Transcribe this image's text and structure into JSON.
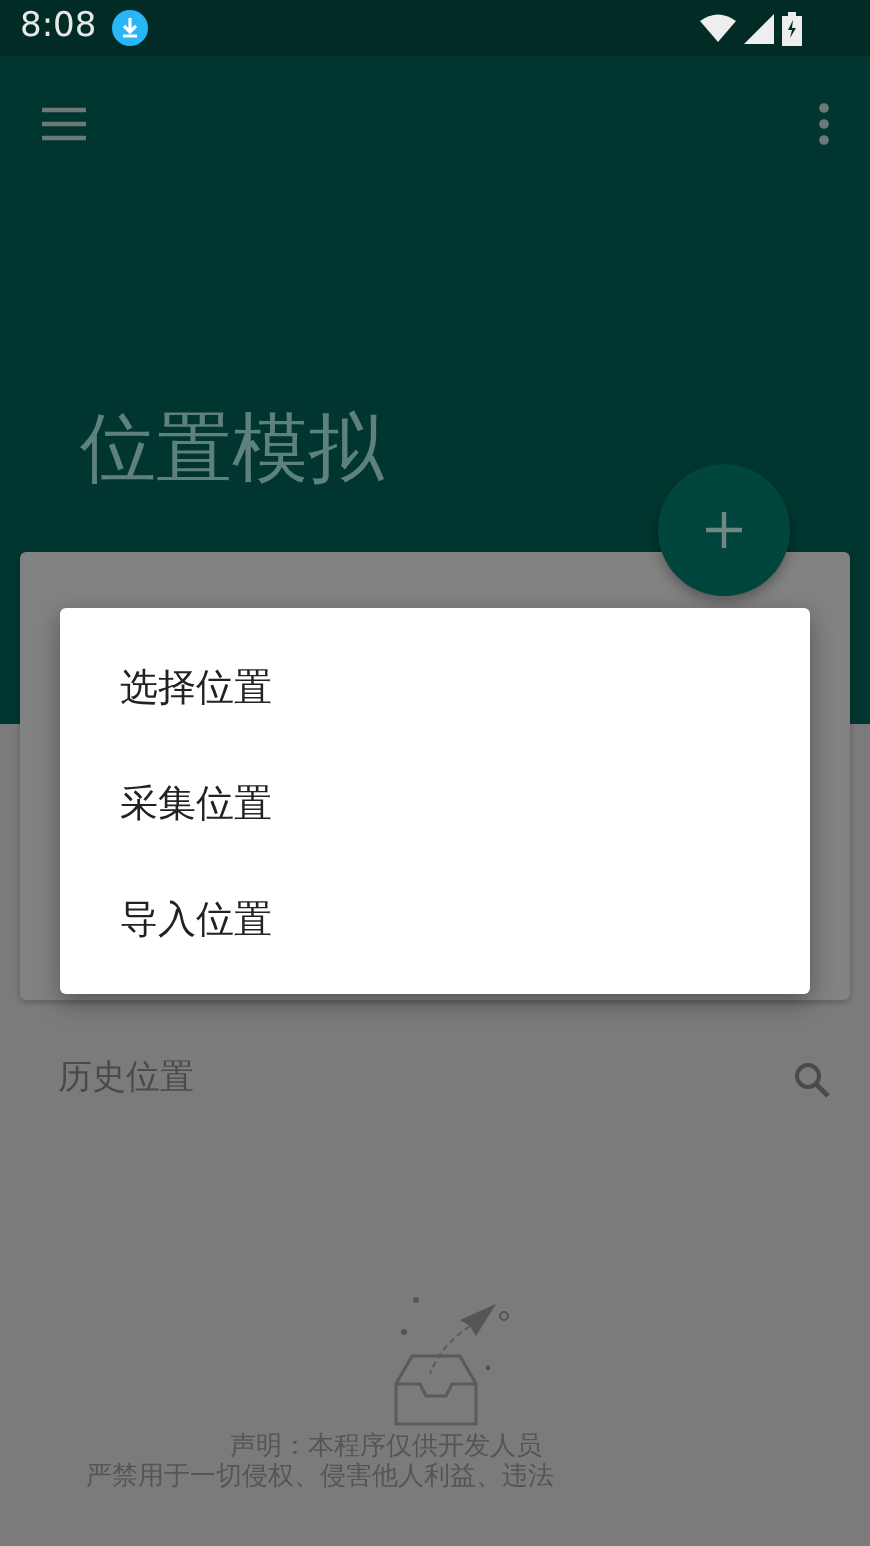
{
  "status_bar": {
    "time": "8:08"
  },
  "app_bar": {
    "title": "位置模拟"
  },
  "menu": {
    "items": [
      {
        "label": "选择位置"
      },
      {
        "label": "采集位置"
      },
      {
        "label": "导入位置"
      }
    ]
  },
  "history": {
    "title": "历史位置"
  },
  "disclaimer": [
    "声明：本程序仅供开发人员",
    "严禁用于一切侵权、侵害他人利益、违法"
  ]
}
